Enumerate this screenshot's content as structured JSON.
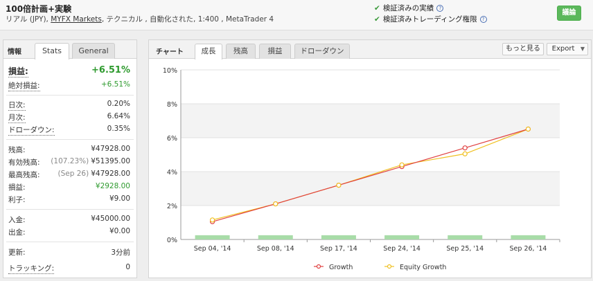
{
  "header": {
    "title": "100倍計画+実験",
    "subtitle_prefix": "リアル (JPY), ",
    "broker_link": "MYFX Markets",
    "subtitle_suffix": ", テクニカル , 自動化された, 1:400 , MetaTrader 4",
    "verify_1": "検証済みの実績",
    "verify_2": "検証済みトレーディング権限",
    "discuss_button": "議論"
  },
  "left": {
    "label": "情報",
    "tab_stats": "Stats",
    "tab_general": "General",
    "gain_label": "損益:",
    "gain_value": "+6.51%",
    "abs_gain_label": "絶対損益:",
    "abs_gain_value": "+6.51%",
    "daily_label": "日次:",
    "daily_value": "0.20%",
    "monthly_label": "月次:",
    "monthly_value": "6.64%",
    "drawdown_label": "ドローダウン:",
    "drawdown_value": "0.35%",
    "balance_label": "残高:",
    "balance_value": "¥47928.00",
    "equity_label": "有効残高:",
    "equity_pct": "(107.23%)",
    "equity_value": "¥51395.00",
    "highest_label": "最高残高:",
    "highest_date": "(Sep 26)",
    "highest_value": "¥47928.00",
    "profit_label": "損益:",
    "profit_value": "¥2928.00",
    "interest_label": "利子:",
    "interest_value": "¥9.00",
    "deposits_label": "入金:",
    "deposits_value": "¥45000.00",
    "withdrawals_label": "出金:",
    "withdrawals_value": "¥0.00",
    "updated_label": "更新:",
    "updated_value": "3分前",
    "tracking_label": "トラッキング:",
    "tracking_value": "0"
  },
  "right": {
    "label": "チャート",
    "tabs": [
      "成長",
      "残高",
      "損益",
      "ドローダウン"
    ],
    "more_button": "もっと見る",
    "export_button": "Export"
  },
  "chart_data": {
    "type": "line",
    "categories": [
      "Sep 04, '14",
      "Sep 08, '14",
      "Sep 17, '14",
      "Sep 24, '14",
      "Sep 25, '14",
      "Sep 26, '14"
    ],
    "series": [
      {
        "name": "Growth",
        "values": [
          1.05,
          2.1,
          3.2,
          4.3,
          5.4,
          6.51
        ],
        "color": "#e04040"
      },
      {
        "name": "Equity Growth",
        "values": [
          1.15,
          2.1,
          3.2,
          4.4,
          5.05,
          6.51
        ],
        "color": "#f0c020"
      }
    ],
    "bars": {
      "values": [
        0.25,
        0.25,
        0.25,
        0.25,
        0.25,
        0.25
      ],
      "color": "#a8dca8"
    },
    "ylim": [
      0,
      10
    ],
    "yticks": [
      "0%",
      "2%",
      "4%",
      "6%",
      "8%",
      "10%"
    ],
    "grid": true,
    "legend_placement": "bottom"
  }
}
